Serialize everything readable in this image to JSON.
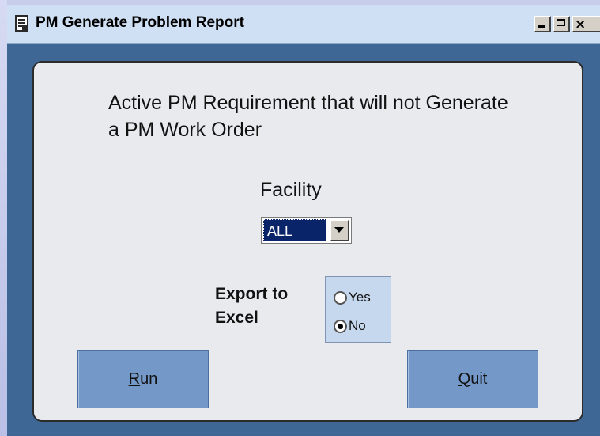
{
  "window": {
    "title": "PM Generate Problem Report",
    "controls": {
      "close_glyph": "×"
    }
  },
  "form": {
    "heading": "Active PM Requirement that will not Generate a PM Work Order",
    "facility": {
      "label": "Facility",
      "selected": "ALL"
    },
    "export": {
      "label": "Export to Excel",
      "options": [
        {
          "label": "Yes",
          "checked": false
        },
        {
          "label": "No",
          "checked": true
        }
      ]
    },
    "buttons": {
      "run": {
        "mnemonic": "R",
        "rest": "un"
      },
      "quit": {
        "mnemonic": "Q",
        "rest": "uit"
      }
    }
  },
  "colors": {
    "window_background": "#3e6796",
    "panel_background": "#e9eaee",
    "button_background": "#7498c8",
    "option_group_background": "#c6d8ee",
    "selection_highlight": "#0a246a"
  },
  "icons": [
    "form-icon",
    "minimize-icon",
    "maximize-icon",
    "close-icon",
    "dropdown-arrow-icon"
  ]
}
